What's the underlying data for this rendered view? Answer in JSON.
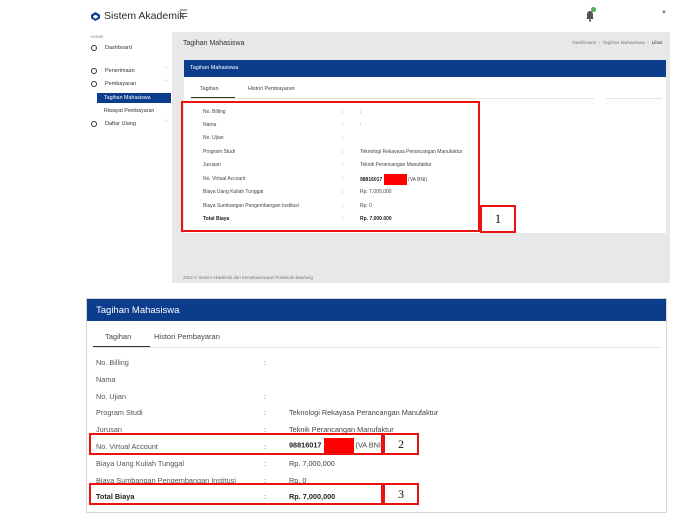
{
  "top": {
    "brand": "Sistem Akademik",
    "sidebar": {
      "heading": "HOME",
      "dashboard": "Dashboard",
      "penerimaan": "Penerimaan",
      "pembayaran": "Pembayaran",
      "tagihan_mahasiswa": "Tagihan Mahasiswa",
      "riwayat_pembayaran": "Riwayat Pembayaran",
      "daftar_ulang": "Daftar Ulang"
    },
    "page_title": "Tagihan Mahasiswa",
    "breadcrumbs": [
      "Dashboard",
      "Tagihan Mahasiswa",
      "Lihat"
    ],
    "card_title": "Tagihan Mahasiswa",
    "tabs": [
      "Tagihan",
      "Histori Pembayaran"
    ],
    "rows": [
      {
        "label": "No. Billing",
        "sep": ":",
        "value": ":"
      },
      {
        "label": "Nama",
        "sep": ":",
        "value": ":"
      },
      {
        "label": "No. Ujian",
        "sep": ":",
        "value": ""
      },
      {
        "label": "Program Studi",
        "sep": ":",
        "value": "Teknologi Rekayasa Perancangan Manufaktur"
      },
      {
        "label": "Jurusan",
        "sep": ":",
        "value": "Teknik Perancangan Manufaktur"
      },
      {
        "label": "No. Virtual Account",
        "sep": ":",
        "value": "98816017",
        "suffix": "(VA BNI)"
      },
      {
        "label": "Biaya Uang Kuliah Tunggal",
        "sep": ":",
        "value": "Rp. 7,000,000"
      },
      {
        "label": "Biaya Sumbangan Pengembangan Institusi",
        "sep": ":",
        "value": "Rp. 0"
      },
      {
        "label": "Total Biaya",
        "sep": ":",
        "value": "Rp. 7.000.000"
      }
    ],
    "footer": "2022 © Sistem Akademik dan Kemahasiswaan Politeknik Bandung"
  },
  "bottom": {
    "card_title": "Tagihan Mahasiswa",
    "tabs": [
      "Tagihan",
      "Histori Pembayaran"
    ],
    "rows": [
      {
        "label": "No. Billing",
        "sep": ":",
        "value": ""
      },
      {
        "label": "Nama",
        "sep": "",
        "value": ""
      },
      {
        "label": "No. Ujian",
        "sep": ":",
        "value": ""
      },
      {
        "label": "Program Studi",
        "sep": ":",
        "value": "Teknologi Rekayasa Perancangan Manufaktur"
      },
      {
        "label": "Jurusan",
        "sep": ":",
        "value": "Teknik Perancangan Manufaktur"
      },
      {
        "label": "No. Virtual Account",
        "sep": ":",
        "value": "98816017",
        "suffix": "(VA BNI)"
      },
      {
        "label": "Biaya Uang Kuliah Tunggal",
        "sep": ":",
        "value": "Rp. 7,000,000"
      },
      {
        "label": "Biaya Sumbangan Pengembangan Institusi",
        "sep": ":",
        "value": "Rp. 0"
      },
      {
        "label": "Total Biaya",
        "sep": ":",
        "value": "Rp. 7,000,000"
      }
    ]
  },
  "callouts": [
    "1",
    "2",
    "3"
  ],
  "colors": {
    "header_blue": "#0b3d8c",
    "annotation_red": "#ee1111",
    "redaction": "#ff0000",
    "notif_green": "#4caf50"
  }
}
